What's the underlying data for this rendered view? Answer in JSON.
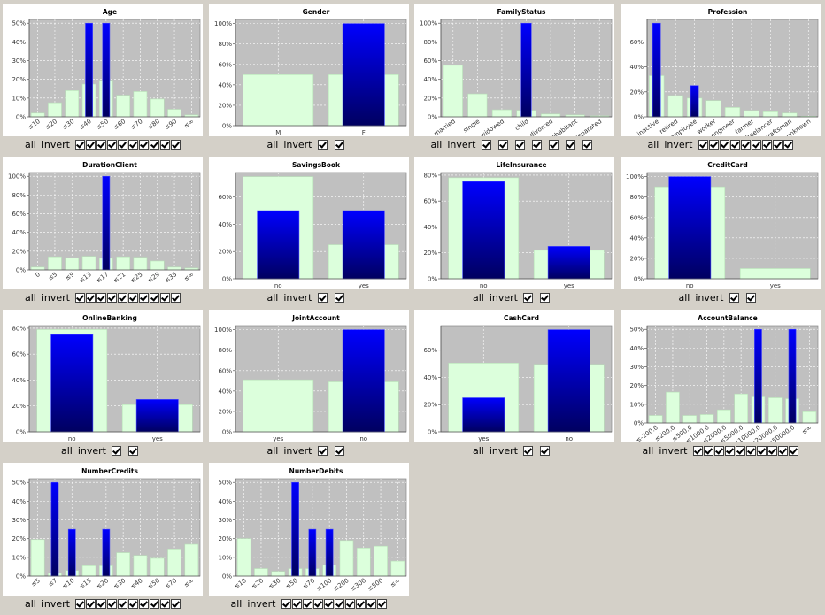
{
  "controls": {
    "all_label": "all",
    "invert_label": "invert"
  },
  "colors": {
    "plot_bg": "#c0c0c0",
    "base_bar": "#dcffdc",
    "base_bar_edge": "#b8e0b8",
    "sel_top": "#0000ff",
    "sel_bottom": "#000060",
    "grid": "#ffffff",
    "panel_bg": "#ffffff",
    "window_bg": "#d4d0c8"
  },
  "chart_data": [
    {
      "name": "Age",
      "type": "bar",
      "title": "Age",
      "categories": [
        "≤10",
        "≤20",
        "≤30",
        "≤40",
        "≤50",
        "≤60",
        "≤70",
        "≤80",
        "≤90",
        "≤∞"
      ],
      "base": [
        2,
        7.5,
        14,
        17.5,
        19.5,
        11.5,
        13.5,
        9.5,
        4,
        1
      ],
      "sel": [
        null,
        null,
        null,
        50,
        50,
        null,
        null,
        null,
        null,
        null
      ],
      "yticks": [
        0,
        10,
        20,
        30,
        40,
        50
      ],
      "ylim": [
        0,
        52
      ],
      "rotate": true,
      "checkboxes": 10,
      "spaced": false
    },
    {
      "name": "Gender",
      "type": "bar",
      "title": "Gender",
      "categories": [
        "M",
        "F"
      ],
      "base": [
        50,
        50
      ],
      "sel": [
        null,
        100
      ],
      "yticks": [
        0,
        20,
        40,
        60,
        80,
        100
      ],
      "ylim": [
        0,
        104
      ],
      "rotate": false,
      "checkboxes": 2,
      "spaced": true
    },
    {
      "name": "FamilyStatus",
      "type": "bar",
      "title": "FamilyStatus",
      "categories": [
        "married",
        "single",
        "widowed",
        "child",
        "divorced",
        "cohabitant",
        "separated"
      ],
      "base": [
        55,
        24.5,
        7.5,
        7,
        3,
        2,
        1
      ],
      "sel": [
        null,
        null,
        null,
        100,
        null,
        null,
        null
      ],
      "yticks": [
        0,
        20,
        40,
        60,
        80,
        100
      ],
      "ylim": [
        0,
        104
      ],
      "rotate": true,
      "checkboxes": 7,
      "spaced": true
    },
    {
      "name": "Profession",
      "type": "bar",
      "title": "Profession",
      "categories": [
        "inactive",
        "retired",
        "employee",
        "worker",
        "technician,engineer",
        "farmer",
        "manager,freelancer",
        "craftsman",
        "unknown"
      ],
      "base": [
        33,
        17,
        15,
        13,
        7.5,
        5,
        4,
        3,
        0.5
      ],
      "sel": [
        75,
        null,
        25,
        null,
        null,
        null,
        null,
        null,
        null
      ],
      "yticks": [
        0,
        20,
        40,
        60
      ],
      "ylim": [
        0,
        78
      ],
      "rotate": true,
      "checkboxes": 9,
      "spaced": false
    },
    {
      "name": "DurationClient",
      "type": "bar",
      "title": "DurationClient",
      "categories": [
        "0",
        "≤5",
        "≤9",
        "≤13",
        "≤17",
        "≤21",
        "≤25",
        "≤29",
        "≤33",
        "≤∞"
      ],
      "base": [
        3,
        14,
        13,
        14.5,
        12.5,
        14,
        13.5,
        9.5,
        3,
        2
      ],
      "sel": [
        null,
        null,
        null,
        null,
        100,
        null,
        null,
        null,
        null,
        null
      ],
      "yticks": [
        0,
        20,
        40,
        60,
        80,
        100
      ],
      "ylim": [
        0,
        104
      ],
      "rotate": true,
      "checkboxes": 10,
      "spaced": false
    },
    {
      "name": "SavingsBook",
      "type": "bar",
      "title": "SavingsBook",
      "categories": [
        "no",
        "yes"
      ],
      "base": [
        75,
        25
      ],
      "sel": [
        50,
        50
      ],
      "yticks": [
        0,
        20,
        40,
        60
      ],
      "ylim": [
        0,
        78
      ],
      "rotate": false,
      "checkboxes": 2,
      "spaced": true
    },
    {
      "name": "LifeInsurance",
      "type": "bar",
      "title": "LifeInsurance",
      "categories": [
        "no",
        "yes"
      ],
      "base": [
        78,
        22
      ],
      "sel": [
        75,
        25
      ],
      "yticks": [
        0,
        20,
        40,
        60,
        80
      ],
      "ylim": [
        0,
        82
      ],
      "rotate": false,
      "checkboxes": 2,
      "spaced": true
    },
    {
      "name": "CreditCard",
      "type": "bar",
      "title": "CreditCard",
      "categories": [
        "no",
        "yes"
      ],
      "base": [
        90,
        10
      ],
      "sel": [
        100,
        null
      ],
      "yticks": [
        0,
        20,
        40,
        60,
        80,
        100
      ],
      "ylim": [
        0,
        104
      ],
      "rotate": false,
      "checkboxes": 2,
      "spaced": true
    },
    {
      "name": "OnlineBanking",
      "type": "bar",
      "title": "OnlineBanking",
      "categories": [
        "no",
        "yes"
      ],
      "base": [
        79,
        21
      ],
      "sel": [
        75,
        25
      ],
      "yticks": [
        0,
        20,
        40,
        60,
        80
      ],
      "ylim": [
        0,
        82
      ],
      "rotate": false,
      "checkboxes": 2,
      "spaced": true
    },
    {
      "name": "JointAccount",
      "type": "bar",
      "title": "JointAccount",
      "categories": [
        "yes",
        "no"
      ],
      "base": [
        51,
        49
      ],
      "sel": [
        null,
        100
      ],
      "yticks": [
        0,
        20,
        40,
        60,
        80,
        100
      ],
      "ylim": [
        0,
        104
      ],
      "rotate": false,
      "checkboxes": 2,
      "spaced": true
    },
    {
      "name": "CashCard",
      "type": "bar",
      "title": "CashCard",
      "categories": [
        "yes",
        "no"
      ],
      "base": [
        50.5,
        49.5
      ],
      "sel": [
        25,
        75
      ],
      "yticks": [
        0,
        20,
        40,
        60
      ],
      "ylim": [
        0,
        78
      ],
      "rotate": false,
      "checkboxes": 2,
      "spaced": true
    },
    {
      "name": "AccountBalance",
      "type": "bar",
      "title": "AccountBalance",
      "categories": [
        "≤-200.0",
        "≤200.0",
        "≤500.0",
        "≤1000.0",
        "≤2000.0",
        "≤5000.0",
        "≤10000.0",
        "≤20000.0",
        "≤50000.0",
        "≤∞"
      ],
      "base": [
        4,
        16.5,
        4,
        4.5,
        7,
        15.5,
        14,
        13.5,
        13,
        6
      ],
      "sel": [
        null,
        null,
        null,
        null,
        null,
        null,
        50,
        null,
        50,
        null
      ],
      "yticks": [
        0,
        10,
        20,
        30,
        40,
        50
      ],
      "ylim": [
        0,
        52
      ],
      "rotate": true,
      "checkboxes": 10,
      "spaced": false
    },
    {
      "name": "NumberCredits",
      "type": "bar",
      "title": "NumberCredits",
      "categories": [
        "≤5",
        "≤7",
        "≤10",
        "≤15",
        "≤20",
        "≤30",
        "≤40",
        "≤50",
        "≤70",
        "≤∞"
      ],
      "base": [
        19.5,
        1.5,
        3,
        5.5,
        5.5,
        12.5,
        11,
        9.5,
        14.5,
        17
      ],
      "sel": [
        null,
        50,
        25,
        null,
        25,
        null,
        null,
        null,
        null,
        null
      ],
      "yticks": [
        0,
        10,
        20,
        30,
        40,
        50
      ],
      "ylim": [
        0,
        52
      ],
      "rotate": true,
      "checkboxes": 10,
      "spaced": false
    },
    {
      "name": "NumberDebits",
      "type": "bar",
      "title": "NumberDebits",
      "categories": [
        "≤10",
        "≤20",
        "≤30",
        "≤50",
        "≤70",
        "≤100",
        "≤200",
        "≤300",
        "≤500",
        "≤∞"
      ],
      "base": [
        20,
        4,
        2.5,
        4,
        4,
        6,
        19,
        15,
        16,
        8
      ],
      "sel": [
        null,
        null,
        null,
        50,
        25,
        25,
        null,
        null,
        null,
        null
      ],
      "yticks": [
        0,
        10,
        20,
        30,
        40,
        50
      ],
      "ylim": [
        0,
        52
      ],
      "rotate": true,
      "checkboxes": 10,
      "spaced": false
    }
  ]
}
